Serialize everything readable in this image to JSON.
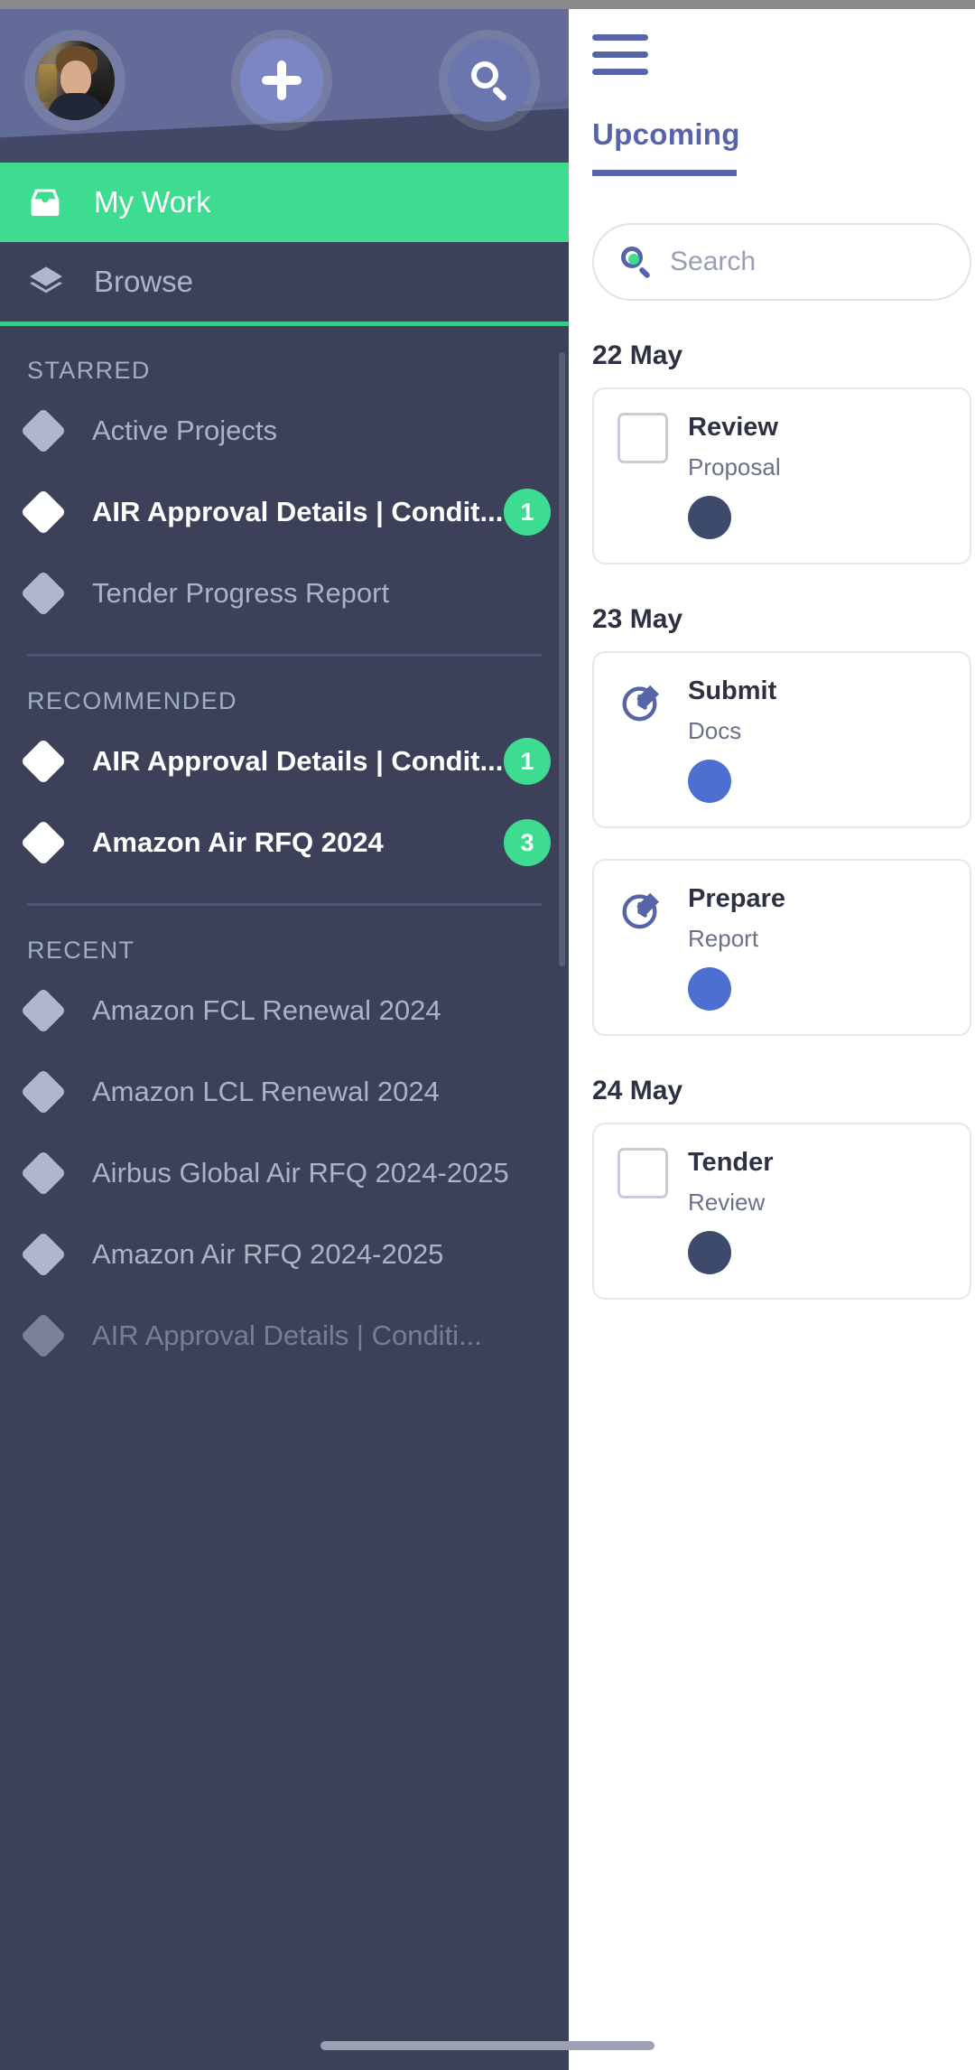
{
  "header": {
    "avatar_name": "user-avatar",
    "add_button_label": "+",
    "search_button_label": "search"
  },
  "nav": {
    "primary": [
      {
        "label": "My Work",
        "icon": "inbox-icon",
        "active": true
      },
      {
        "label": "Browse",
        "icon": "layers-icon",
        "active": false
      }
    ]
  },
  "sections": [
    {
      "title": "STARRED",
      "items": [
        {
          "label": "Active Projects",
          "highlighted": false,
          "badge": ""
        },
        {
          "label": "AIR Approval Details | Condit...",
          "highlighted": true,
          "badge": "1"
        },
        {
          "label": "Tender Progress Report",
          "highlighted": false,
          "badge": ""
        }
      ]
    },
    {
      "title": "RECOMMENDED",
      "items": [
        {
          "label": "AIR Approval Details | Condit...",
          "highlighted": true,
          "badge": "1"
        },
        {
          "label": "Amazon Air RFQ 2024",
          "highlighted": true,
          "badge": "3"
        }
      ]
    },
    {
      "title": "RECENT",
      "items": [
        {
          "label": "Amazon FCL Renewal 2024",
          "highlighted": false,
          "badge": ""
        },
        {
          "label": "Amazon LCL Renewal 2024",
          "highlighted": false,
          "badge": ""
        },
        {
          "label": "Airbus Global Air RFQ 2024-2025",
          "highlighted": false,
          "badge": ""
        },
        {
          "label": "Amazon Air RFQ 2024-2025",
          "highlighted": false,
          "badge": ""
        },
        {
          "label": "AIR Approval Details | Conditi...",
          "highlighted": false,
          "badge": ""
        }
      ]
    }
  ],
  "right_panel": {
    "menu_icon": "hamburger-menu-icon",
    "tab_label": "Upcoming",
    "search_placeholder": "Search",
    "groups": [
      {
        "date": "22 May",
        "cards": [
          {
            "lead": "checkbox",
            "title": "Review",
            "subtitle": "Proposal"
          }
        ]
      },
      {
        "date": "23 May",
        "cards": [
          {
            "lead": "task-icon",
            "title": "Submit",
            "subtitle": "Docs"
          },
          {
            "lead": "task-icon",
            "title": "Prepare",
            "subtitle": "Report"
          }
        ]
      },
      {
        "date": "24 May",
        "cards": [
          {
            "lead": "checkbox",
            "title": "Tender",
            "subtitle": "Review"
          }
        ]
      }
    ]
  },
  "colors": {
    "accent_green": "#3ddc91",
    "drawer_bg": "#3c4059",
    "header_bg": "#5b6390",
    "panel_accent": "#5864a8"
  }
}
